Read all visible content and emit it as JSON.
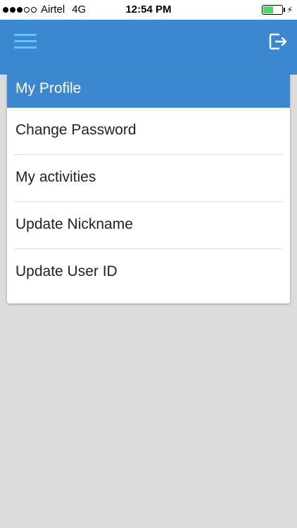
{
  "status_bar": {
    "carrier": "Airtel",
    "network": "4G",
    "time": "12:54 PM",
    "signal_total": 5,
    "signal_filled": 3,
    "battery_level_percent": 55,
    "battery_color": "#4cd964"
  },
  "app_bar": {
    "color": "#3b87d0",
    "menu_icon": "hamburger-menu-icon",
    "logout_icon": "logout-icon"
  },
  "card": {
    "header": "My Profile",
    "items": [
      {
        "label": "Change Password"
      },
      {
        "label": "My activities"
      },
      {
        "label": "Update Nickname"
      },
      {
        "label": "Update User ID"
      }
    ]
  }
}
